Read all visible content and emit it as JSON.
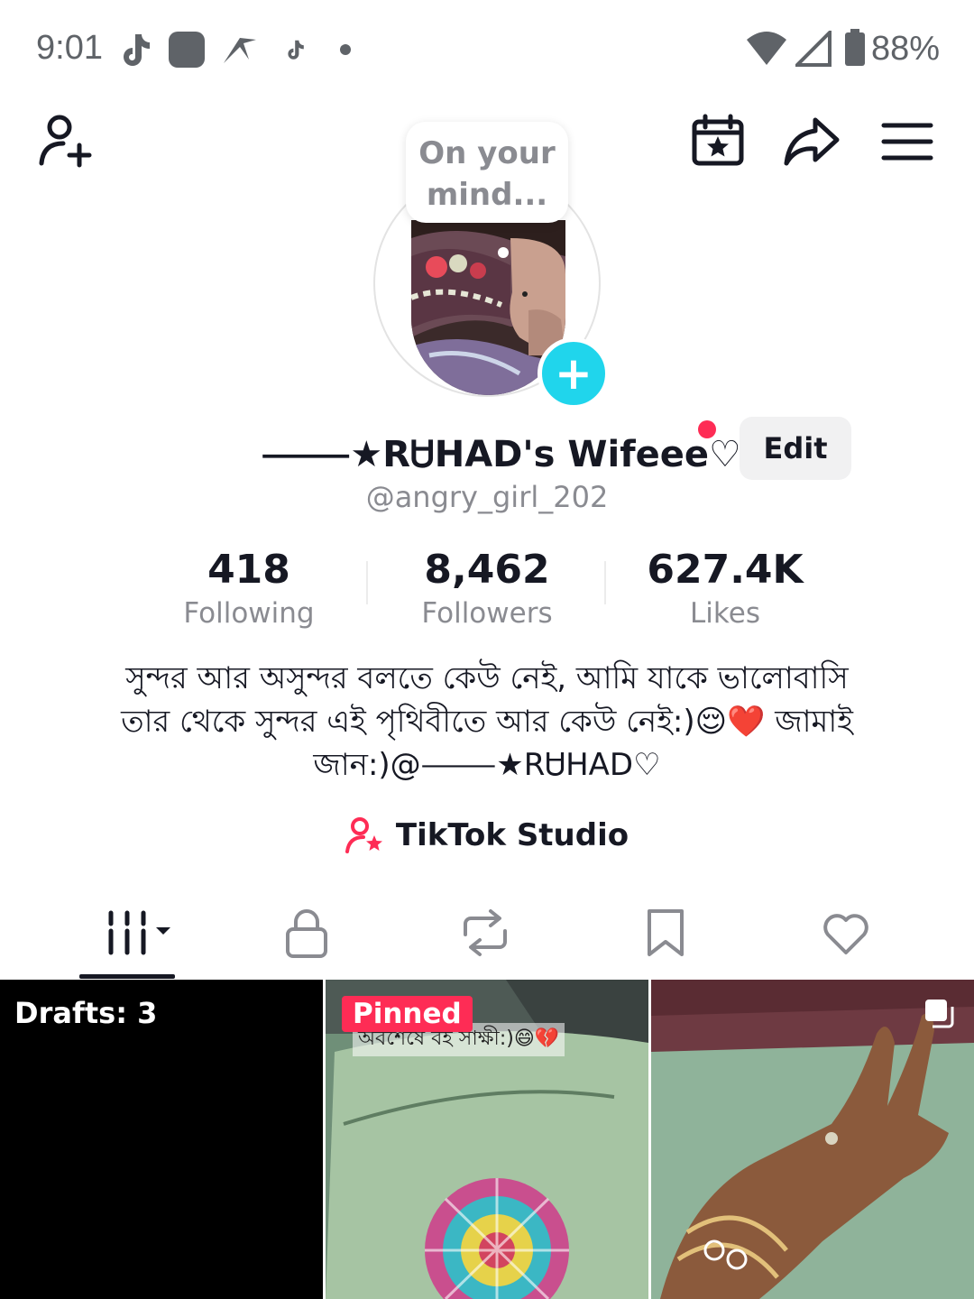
{
  "status_bar": {
    "time": "9:01",
    "battery": "88%",
    "icons": [
      "tiktok-icon",
      "app-square-icon",
      "signal-app-icon",
      "tiktok-small-icon",
      "notification-dot-icon",
      "wifi-icon",
      "cellular-icon",
      "battery-icon"
    ]
  },
  "top_bar": {
    "icons": [
      "add-friend-icon",
      "calendar-star-icon",
      "share-icon",
      "menu-icon"
    ]
  },
  "avatar": {
    "bubble_text": "On your mind...",
    "plus_symbol": "+"
  },
  "profile": {
    "display_name": "⸻★RᏌHAD's Wifeee♡",
    "username": "@angry_girl_202",
    "edit_label": "Edit"
  },
  "stats": [
    {
      "value": "418",
      "label": "Following"
    },
    {
      "value": "8,462",
      "label": "Followers"
    },
    {
      "value": "627.4K",
      "label": "Likes"
    }
  ],
  "bio": {
    "line1": "সুন্দর আর অসুন্দর বলতে কেউ নেই, আমি যাকে ভালোবাসি",
    "line2": "তার থেকে সুন্দর এই পৃথিবীতে আর কেউ নেই:)😌❤️ জামাই",
    "line3": "জান:)@⸻★RᏌHAD♡"
  },
  "studio": {
    "label": "TikTok Studio"
  },
  "tabs": [
    "videos-grid-tab",
    "private-tab",
    "reposts-tab",
    "favorites-tab",
    "liked-tab"
  ],
  "grid": {
    "drafts_label": "Drafts: 3",
    "pinned_label": "Pinned",
    "pinned_overlay_text": "অবশেষে বই সাক্ষী:)😄💔"
  },
  "colors": {
    "accent_red": "#fe2c55",
    "accent_cyan": "#20d5ec",
    "text_primary": "#161823",
    "text_secondary": "#8a8b91"
  }
}
